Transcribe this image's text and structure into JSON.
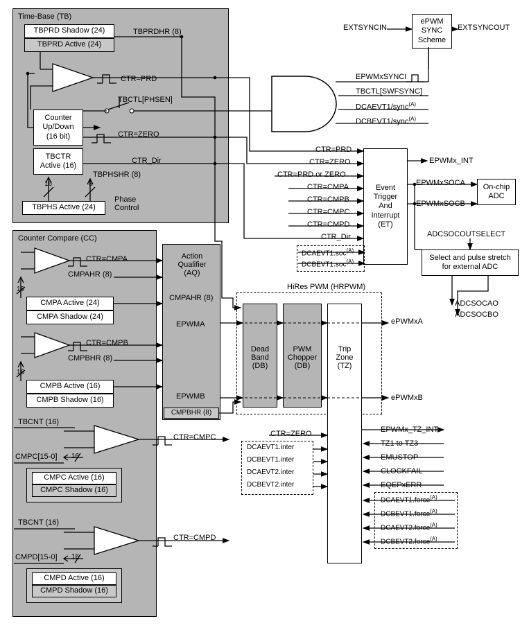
{
  "tb": {
    "title": "Time-Base (TB)",
    "tbprd_shadow": "TBPRD Shadow (24)",
    "tbprd_active": "TBPRD Active (24)",
    "tbprdhr": "TBPRDHR (8)",
    "ctr_prd": "CTR=PRD",
    "tbctl_phsen": "TBCTL[PHSEN]",
    "counter": "Counter\nUp/Down\n(16 bit)",
    "tbctr": "TBCTR\nActive (16)",
    "ctr_zero": "CTR=ZERO",
    "ctr_dir": "CTR_Dir",
    "tbphshr": "TBPHSHR (8)",
    "tbphs": "TBPHS Active (24)",
    "phase_ctrl": "Phase\nControl",
    "w16": "16",
    "w8": "8"
  },
  "cc": {
    "title": "Counter Compare (CC)",
    "ctr_cmpa": "CTR=CMPA",
    "cmpahr": "CMPAHR (8)",
    "cmpa_active": "CMPA Active (24)",
    "cmpa_shadow": "CMPA Shadow (24)",
    "ctr_cmpb": "CTR=CMPB",
    "cmpbhr": "CMPBHR (8)",
    "cmpb_active": "CMPB Active (16)",
    "cmpb_shadow": "CMPB Shadow (16)",
    "tbcnt1": "TBCNT (16)",
    "ctr_cmpc": "CTR=CMPC",
    "cmpc_slice": "CMPC[15-0]",
    "cmpc_active": "CMPC Active (16)",
    "cmpc_shadow": "CMPC Shadow (16)",
    "tbcnt2": "TBCNT (16)",
    "ctr_cmpd": "CTR=CMPD",
    "cmpd_slice": "CMPD[15-0]",
    "cmpd_active": "CMPD Active (16)",
    "cmpd_shadow": "CMPD Shadow (16)",
    "w16": "16"
  },
  "aq": {
    "title": "Action\nQualifier\n(AQ)",
    "cmpahr": "CMPAHR (8)",
    "epwma": "EPWMA",
    "epwmb": "EPWMB",
    "cmpbhr": "CMPBHR (8)"
  },
  "hrpwm": {
    "title": "HiRes PWM (HRPWM)",
    "db": "Dead\nBand\n(DB)",
    "pc": "PWM\nChopper\n(DB)",
    "tz": "Trip\nZone\n(TZ)"
  },
  "et": {
    "block": "Event\nTrigger\nAnd\nInterrupt\n(ET)",
    "ctr_prd": "CTR=PRD",
    "ctr_zero": "CTR=ZERO",
    "ctr_prd_or_zero": "CTR=PRD or ZERO",
    "ctr_cmpa": "CTR=CMPA",
    "ctr_cmpb": "CTR=CMPB",
    "ctr_cmpc": "CTR=CMPC",
    "ctr_cmpd": "CTR=CMPD",
    "ctr_dir": "CTR_Dir",
    "dca_soc": "DCAEVT1.soc",
    "dcb_soc": "DCBEVT1.soc",
    "epwmx_int": "EPWMx_INT",
    "epwm_soca": "EPWMxSOCA",
    "epwm_socb": "EPWMxSOCB"
  },
  "adc": {
    "onchip": "On-chip\nADC",
    "selectout": "ADCSOCOUTSELECT",
    "stretch": "Select and pulse stretch\nfor external ADC",
    "adcsocao": "ADCSOCAO",
    "adcsocbo": "ADCSOCBO"
  },
  "sync": {
    "extsyncin": "EXTSYNCIN",
    "scheme": "ePWM\nSYNC\nScheme",
    "extsyncout": "EXTSYNCOUT",
    "epwmxsynci": "EPWMxSYNCI",
    "tbctl_swfsync": "TBCTL[SWFSYNC]",
    "dcaevt1_sync": "DCAEVT1/sync",
    "dcbevt1_sync": "DCBEVT1/sync"
  },
  "tz": {
    "ctr_zero": "CTR=ZERO",
    "dcaevt1_inter": "DCAEVT1.inter",
    "dcbevt1_inter": "DCBEVT1.inter",
    "dcaevt2_inter": "DCAEVT2.inter",
    "dcbevt2_inter": "DCBEVT2.inter",
    "epwmx_tz_int": "EPWMx_TZ_INT",
    "tz1_tz3": "TZ1 to TZ3",
    "emustop": "EMUSTOP",
    "clockfail": "CLOCKFAIL",
    "eqeperr": "EQEPxERR",
    "dcaevt1_force": "DCAEVT1.force",
    "dcbevt1_force": "DCBEVT1.force",
    "dcaevt2_force": "DCAEVT2.force",
    "dcbevt2_force": "DCBEVT2.force"
  },
  "out": {
    "epwmxa": "ePWMxA",
    "epwmxb": "ePWMxB"
  },
  "note_a": "(A)"
}
